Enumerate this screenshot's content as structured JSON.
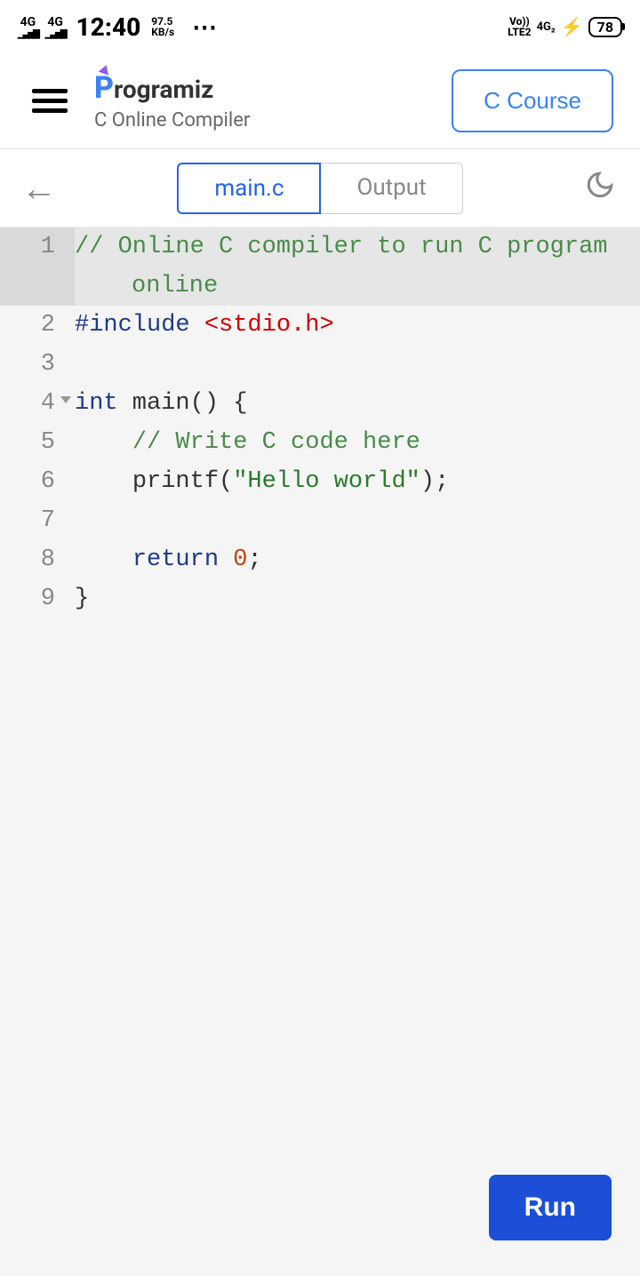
{
  "status": {
    "signal1": "4G",
    "signal2": "4G",
    "time": "12:40",
    "speed_top": "97.5",
    "speed_unit": "KB/s",
    "volte": "Vo))",
    "lte": "LTE2",
    "net": "4G₂",
    "battery": "78"
  },
  "header": {
    "logo_text": "rogramiz",
    "subtitle": "C Online Compiler",
    "course_button": "C Course"
  },
  "tabs": {
    "main": "main.c",
    "output": "Output"
  },
  "code": {
    "line1_a": "// Online C compiler to run C program ",
    "line1_b": "online",
    "line2_pre": "#include",
    "line2_inc": "<stdio.h>",
    "line4_kw": "int",
    "line4_rest": " main() {",
    "line5": "    // Write C code here",
    "line6_a": "    printf(",
    "line6_str": "\"Hello world\"",
    "line6_b": ");",
    "line8_kw": "    return",
    "line8_num": " 0",
    "line8_b": ";",
    "line9": "}"
  },
  "lines": {
    "l1": "1",
    "l2": "2",
    "l3": "3",
    "l4": "4",
    "l5": "5",
    "l6": "6",
    "l7": "7",
    "l8": "8",
    "l9": "9"
  },
  "run": "Run"
}
